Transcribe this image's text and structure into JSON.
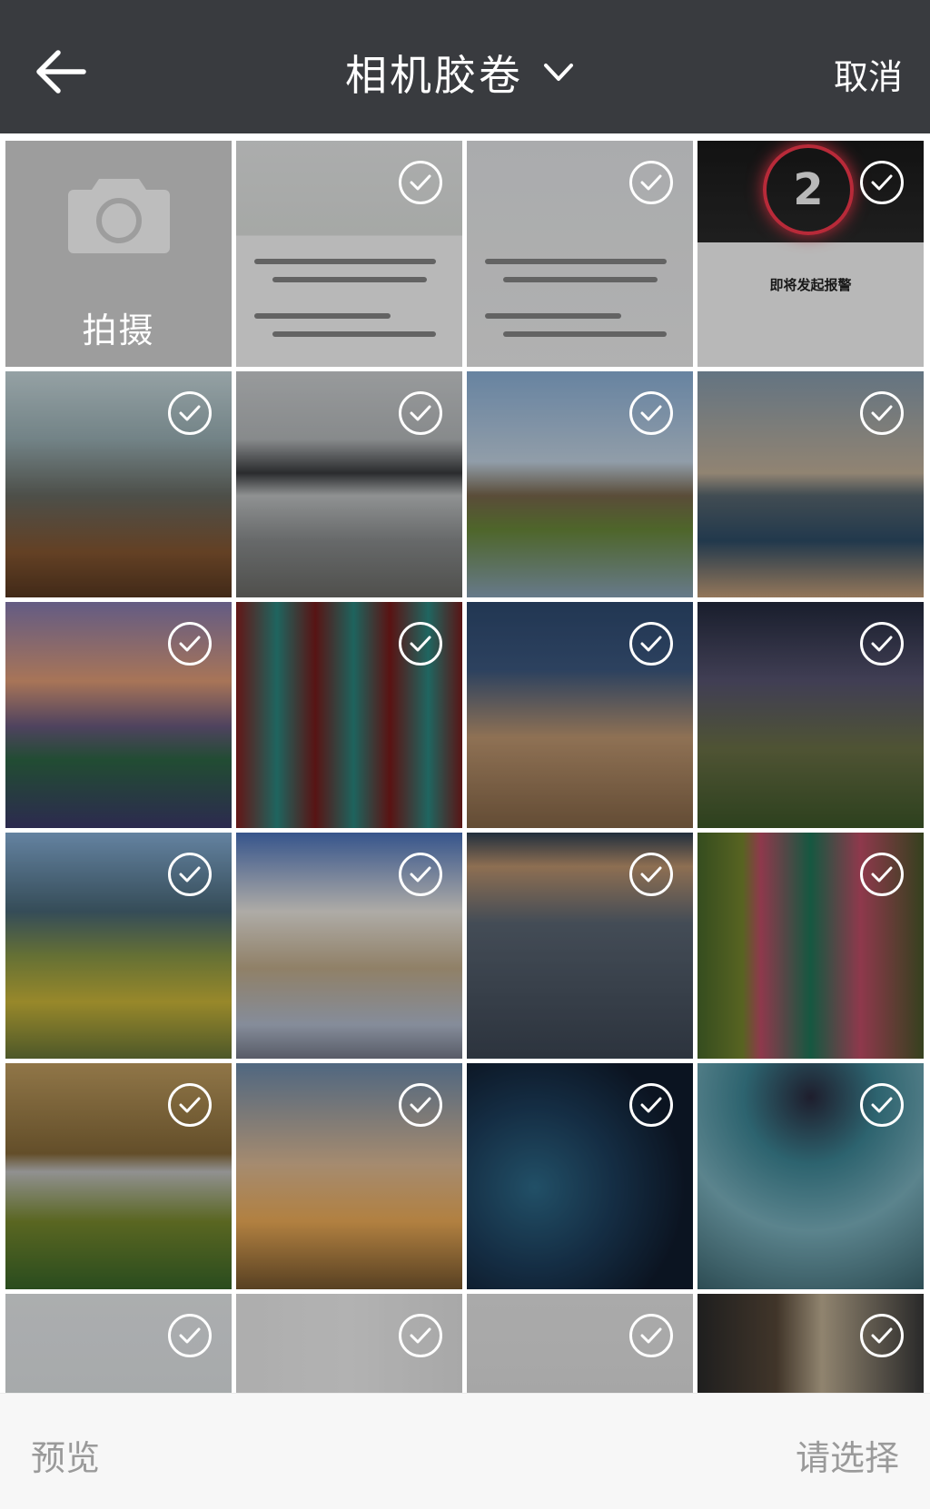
{
  "header": {
    "title": "相机胶卷",
    "cancel_label": "取消"
  },
  "camera_tile": {
    "label": "拍摄"
  },
  "photos": [
    {
      "kind": "screenshot-map",
      "bg": "linear-gradient(#eef0f0 0%, #e6e9e6 42%, #ffffff 42%, #ffffff 100%)"
    },
    {
      "kind": "screenshot-app",
      "bg": "linear-gradient(#eceef0, #f5f5f5)"
    },
    {
      "kind": "screenshot-alert",
      "bg": "linear-gradient(#1a1a1a 0%, #2b2b2b 45%, #ffffff 45%)",
      "count_text": "2",
      "alert_text": "即将发起报警"
    },
    {
      "kind": "library",
      "bg": "linear-gradient(180deg,#cfe0e4 0%,#9fb6bb 30%,#6b6e66 55%,#8a5a33 80%,#5b3a22 100%)"
    },
    {
      "kind": "mountain-lake",
      "bg": "linear-gradient(180deg,#d3d6d8 0%,#bcc0c2 30%,#3b3d40 45%,#c7cacb 55%,#8f9293 75%,#6e6e6a 100%)"
    },
    {
      "kind": "windmill",
      "bg": "linear-gradient(180deg,#8fb6df 0%,#c9daea 40%,#7d6a4f 55%,#6d8d3b 70%,#8fa9c0 100%)"
    },
    {
      "kind": "modern-building",
      "bg": "linear-gradient(180deg,#8aa1b4 0%,#c9b79f 45%,#5b6a73 55%,#2f4f6a 75%,#cda57d 100%)"
    },
    {
      "kind": "castle-sunset",
      "bg": "linear-gradient(180deg,#8a7fb7 0%,#e9a27a 35%,#6e5d84 55%,#2f6a47 70%,#3e3b6e 100%)"
    },
    {
      "kind": "chinese-doors",
      "bg": "linear-gradient(90deg,#8a1f1f 0%,#2b8c84 18%,#7a1c1c 35%,#2a8a82 52%,#7d1b1b 68%,#2c8d86 85%,#7c1d1d 100%)"
    },
    {
      "kind": "tower",
      "bg": "linear-gradient(180deg,#2f4c73 0%,#3e5b84 30%,#c69d75 60%,#8a6a4a 100%)"
    },
    {
      "kind": "milky-way",
      "bg": "linear-gradient(180deg,#232a3e 0%,#5a5775 35%,#6e7448 65%,#3f5a2a 100%)"
    },
    {
      "kind": "karst",
      "bg": "linear-gradient(180deg,#8bb5df 0%,#4a6a7a 35%,#8e9d49 55%,#d3bd3b 75%,#6c7a3a 100%)"
    },
    {
      "kind": "snow-house",
      "bg": "linear-gradient(180deg,#4c76c2 0%,#f2eee7 35%,#c8b28f 60%,#b9c3d6 85%,#7a7f8f 100%)"
    },
    {
      "kind": "bridge",
      "bg": "linear-gradient(180deg,#2f4256 0%,#c59a72 15%,#5e6a78 40%,#3e4856 100%)"
    },
    {
      "kind": "courts",
      "bg": "linear-gradient(90deg,#4a6b2b 0%,#7a8a2f 20%,#c64f6a 28%,#1e7a5a 50%,#c64f6a 72%,#4a5a2a 100%)"
    },
    {
      "kind": "autumn-lake",
      "bg": "linear-gradient(180deg,#c8a464 0%,#8a6d3a 40%,#c9c9c9 48%,#7d8e2f 70%,#3a6a2a 100%)"
    },
    {
      "kind": "dancer",
      "bg": "linear-gradient(180deg,#6f8fb2 0%,#e6c19a 45%,#f6b25a 70%,#7a5a30 100%)"
    },
    {
      "kind": "earth",
      "bg": "radial-gradient(circle at 30% 55%,#2f6f8f 0%,#1d3f5e 40%,#101c2e 75%),linear-gradient(#0b1420,#0b1420)"
    },
    {
      "kind": "tunnel",
      "bg": "radial-gradient(circle at 50% 15%,#2a2a3f 0%,#3f8a9a 30%,#7fb7c4 60%,#3f6a74 100%)"
    },
    {
      "kind": "plant",
      "bg": "linear-gradient(180deg,#eef1f3 0%,#dfe5e7 100%)"
    },
    {
      "kind": "dancer-black",
      "bg": "linear-gradient(90deg,#f1f1f1 0%,#f7f7f7 50%,#e9e9e9 100%)"
    },
    {
      "kind": "suit",
      "bg": "linear-gradient(180deg,#ececec 0%,#e1e1e1 100%)"
    },
    {
      "kind": "runway",
      "bg": "linear-gradient(90deg,#2b2b2b 0%,#5a4a3a 35%,#c8b79a 55%,#3a3a3a 100%)"
    }
  ],
  "footer": {
    "preview_label": "预览",
    "select_label": "请选择"
  },
  "icons": {
    "back": "arrow-left-icon",
    "dropdown": "chevron-down-icon",
    "camera": "camera-icon",
    "check": "check-circle-icon"
  },
  "colors": {
    "header_bg": "#393b3f",
    "footer_bg": "#f7f7f7",
    "footer_text": "#9a9a9a",
    "camera_tile_bg": "#9d9d9d"
  }
}
